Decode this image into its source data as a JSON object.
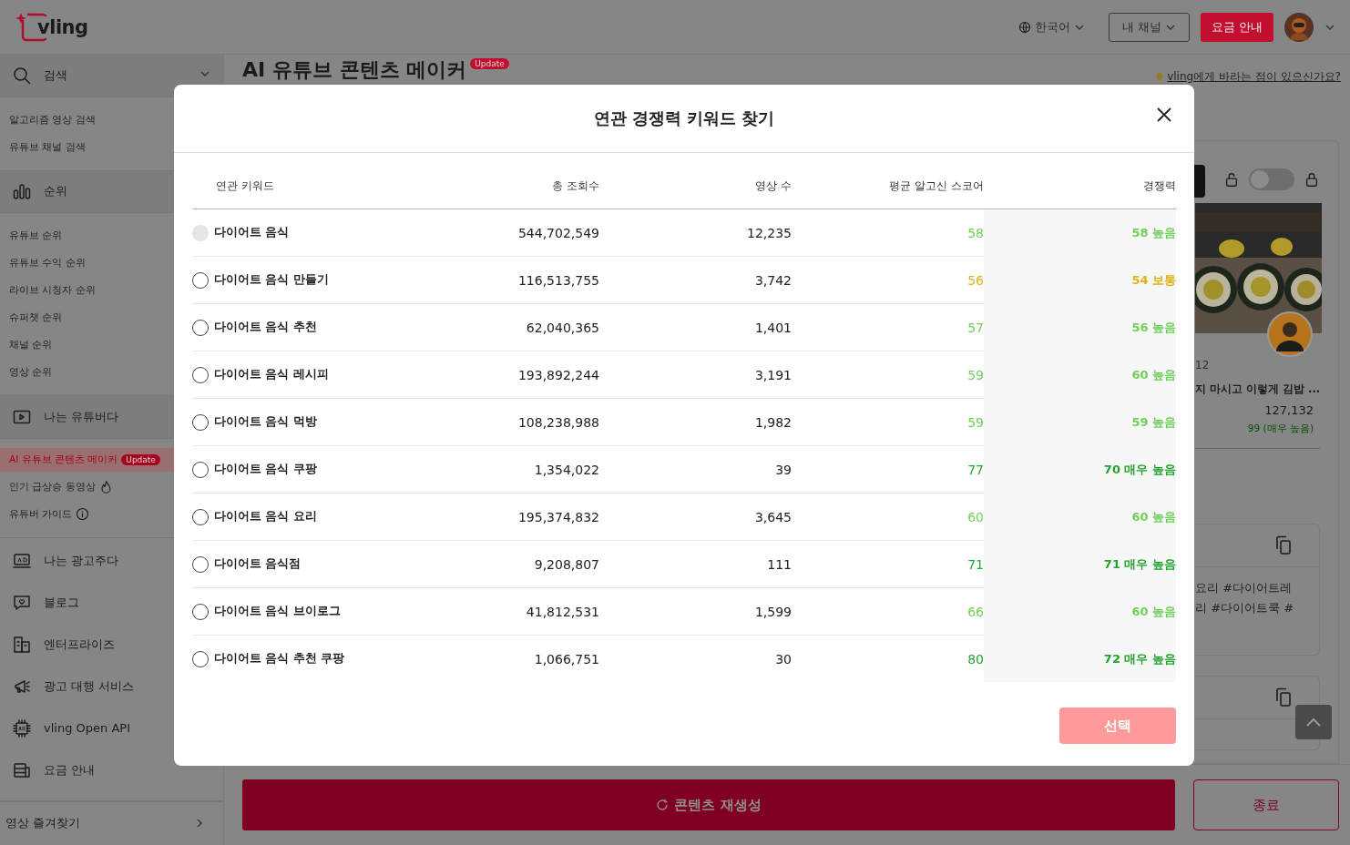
{
  "header": {
    "logo": "vling",
    "language": "한국어",
    "my_channel": "내 채널",
    "pricing_button": "요금 안내"
  },
  "sidebar": {
    "sections": [
      {
        "label": "검색",
        "items": [
          {
            "label": "알고리즘 영상 검색",
            "selected": false
          },
          {
            "label": "유튜브 채널 검색",
            "selected": false
          }
        ]
      },
      {
        "label": "순위",
        "items": [
          {
            "label": "유튜브 순위",
            "selected": false
          },
          {
            "label": "유튜브 수익 순위",
            "selected": false
          },
          {
            "label": "라이브 시청자 순위",
            "selected": false
          },
          {
            "label": "슈퍼챗 순위",
            "selected": false
          },
          {
            "label": "채널 순위",
            "selected": false
          },
          {
            "label": "영상 순위",
            "selected": false
          }
        ]
      },
      {
        "label": "나는 유튜버다",
        "items": [
          {
            "label": "AI 유튜브 콘텐츠 메이커",
            "selected": true,
            "badge": "Update"
          },
          {
            "label": "인기 급상승 동영상",
            "selected": false
          },
          {
            "label": "유튜버 가이드",
            "selected": false
          }
        ]
      },
      {
        "label": "나는 광고주다"
      },
      {
        "label": "블로그"
      },
      {
        "label": "엔터프라이즈"
      },
      {
        "label": "광고 대행 서비스"
      },
      {
        "label": "vling Open API"
      },
      {
        "label": "요금 안내"
      }
    ],
    "footer": "영상 즐겨찾기"
  },
  "main": {
    "title": "AI 유튜브 콘텐츠 메이커",
    "title_badge": "Update",
    "feedback_link": "vling에게 바라는 점이 있으신가요?"
  },
  "right_panel": {
    "toggle": {
      "on": false
    },
    "video": {
      "kind": "picture",
      "date": "12",
      "title": "지 마시고 이렇게 김밥 ...",
      "views": "127,132",
      "score": "99 (매우 높음)"
    },
    "cards": [
      {
        "kind": "text",
        "lines": [
          "요리 #다이어트레",
          "리 #다이어트쿡 #"
        ]
      },
      {
        "kind": "copy"
      }
    ]
  },
  "bottom_bar": {
    "regenerate": "콘텐츠 재생성",
    "close": "종료"
  },
  "modal": {
    "title": "연관 경쟁력 키워드 찾기",
    "columns": [
      "연관 키워드",
      "총 조회수",
      "영상 수",
      "평균 알고신 스코어",
      "경쟁력"
    ],
    "rows": [
      {
        "selected": false,
        "disabled": true,
        "keyword": "다이어트 음식",
        "views": "544,702,549",
        "videos": "12,235",
        "score": {
          "text": "58",
          "color": "#6fd05a"
        },
        "competition": {
          "text": "58 높음",
          "color": "#6fd05a"
        }
      },
      {
        "selected": false,
        "disabled": false,
        "keyword": "다이어트 음식 만들기",
        "views": "116,513,755",
        "videos": "3,742",
        "score": {
          "text": "56",
          "color": "#e0b21a"
        },
        "competition": {
          "text": "54 보통",
          "color": "#e0b21a"
        }
      },
      {
        "selected": false,
        "disabled": false,
        "keyword": "다이어트 음식 추천",
        "views": "62,040,365",
        "videos": "1,401",
        "score": {
          "text": "57",
          "color": "#6fd05a"
        },
        "competition": {
          "text": "56 높음",
          "color": "#6fd05a"
        }
      },
      {
        "selected": false,
        "disabled": false,
        "keyword": "다이어트 음식 레시피",
        "views": "193,892,244",
        "videos": "3,191",
        "score": {
          "text": "59",
          "color": "#6fd05a"
        },
        "competition": {
          "text": "60 높음",
          "color": "#6fd05a"
        }
      },
      {
        "selected": false,
        "disabled": false,
        "keyword": "다이어트 음식 먹방",
        "views": "108,238,988",
        "videos": "1,982",
        "score": {
          "text": "59",
          "color": "#6fd05a"
        },
        "competition": {
          "text": "59 높음",
          "color": "#6fd05a"
        }
      },
      {
        "selected": false,
        "disabled": false,
        "keyword": "다이어트 음식 쿠팡",
        "views": "1,354,022",
        "videos": "39",
        "score": {
          "text": "77",
          "color": "#22a52c"
        },
        "competition": {
          "text": "70 매우 높음",
          "color": "#22a52c"
        }
      },
      {
        "selected": false,
        "disabled": false,
        "keyword": "다이어트 음식 요리",
        "views": "195,374,832",
        "videos": "3,645",
        "score": {
          "text": "60",
          "color": "#6fd05a"
        },
        "competition": {
          "text": "60 높음",
          "color": "#6fd05a"
        }
      },
      {
        "selected": false,
        "disabled": false,
        "keyword": "다이어트 음식점",
        "views": "9,208,807",
        "videos": "111",
        "score": {
          "text": "71",
          "color": "#22a52c"
        },
        "competition": {
          "text": "71 매우 높음",
          "color": "#22a52c"
        }
      },
      {
        "selected": false,
        "disabled": false,
        "keyword": "다이어트 음식 브이로그",
        "views": "41,812,531",
        "videos": "1,599",
        "score": {
          "text": "66",
          "color": "#6fd05a"
        },
        "competition": {
          "text": "60 높음",
          "color": "#6fd05a"
        }
      },
      {
        "selected": false,
        "disabled": false,
        "keyword": "다이어트 음식 추천 쿠팡",
        "views": "1,066,751",
        "videos": "30",
        "score": {
          "text": "80",
          "color": "#22a52c"
        },
        "competition": {
          "text": "72 매우 높음",
          "color": "#22a52c"
        }
      }
    ],
    "select_button": {
      "label": "선택",
      "disabled": true
    }
  }
}
